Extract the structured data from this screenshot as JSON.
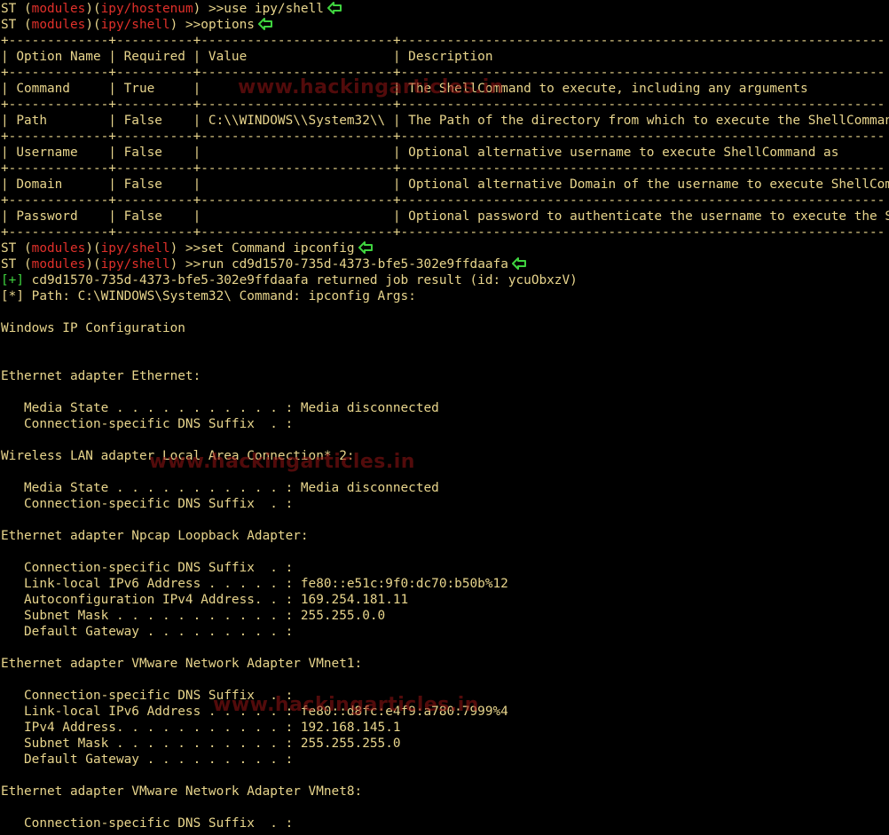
{
  "colors": {
    "background": "#000000",
    "text": "#e8d58c",
    "module_red": "#e0302a",
    "status_green": "#3fd33f",
    "arrow_green": "#3fd33f"
  },
  "prompt": {
    "prefix": "ST (",
    "module_word": "modules",
    "mid": ")(",
    "close": ")",
    "chevron": " >>"
  },
  "commands": {
    "c1": {
      "module": "ipy/hostenum",
      "text": "use ipy/shell"
    },
    "c2": {
      "module": "ipy/shell",
      "text": "options"
    },
    "c3": {
      "module": "ipy/shell",
      "text": "set Command ipconfig"
    },
    "c4": {
      "module": "ipy/shell",
      "text": "run cd9d1570-735d-4373-bfe5-302e9ffdaafa"
    }
  },
  "table": {
    "separator": "+-------------+----------+-------------------------+---------------------------------------------------------------",
    "header": "| Option Name | Required | Value                   | Description",
    "rows": [
      "| Command     | True     |                         | The ShellCommand to execute, including any arguments",
      "| Path        | False    | C:\\\\WINDOWS\\\\System32\\\\ | The Path of the directory from which to execute the ShellCommand",
      "| Username    | False    |                         | Optional alternative username to execute ShellCommand as",
      "| Domain      | False    |                         | Optional alternative Domain of the username to execute ShellCommand",
      "| Password    | False    |                         | Optional password to authenticate the username to execute the ShellCommand"
    ]
  },
  "status": {
    "plus_tag": "[+]",
    "plus_text": " cd9d1570-735d-4373-bfe5-302e9ffdaafa returned job result (id: ycuObxzV)",
    "star_tag": "[*]",
    "star_text": " Path: C:\\WINDOWS\\System32\\ Command: ipconfig Args:"
  },
  "output": [
    "",
    "Windows IP Configuration",
    "",
    "",
    "Ethernet adapter Ethernet:",
    "",
    "   Media State . . . . . . . . . . . : Media disconnected",
    "   Connection-specific DNS Suffix  . :",
    "",
    "Wireless LAN adapter Local Area Connection* 2:",
    "",
    "   Media State . . . . . . . . . . . : Media disconnected",
    "   Connection-specific DNS Suffix  . :",
    "",
    "Ethernet adapter Npcap Loopback Adapter:",
    "",
    "   Connection-specific DNS Suffix  . :",
    "   Link-local IPv6 Address . . . . . : fe80::e51c:9f0:dc70:b50b%12",
    "   Autoconfiguration IPv4 Address. . : 169.254.181.11",
    "   Subnet Mask . . . . . . . . . . . : 255.255.0.0",
    "   Default Gateway . . . . . . . . . :",
    "",
    "Ethernet adapter VMware Network Adapter VMnet1:",
    "",
    "   Connection-specific DNS Suffix  . :",
    "   Link-local IPv6 Address . . . . . : fe80::d8fc:e4f9:a780:7999%4",
    "   IPv4 Address. . . . . . . . . . . : 192.168.145.1",
    "   Subnet Mask . . . . . . . . . . . : 255.255.255.0",
    "   Default Gateway . . . . . . . . . :",
    "",
    "Ethernet adapter VMware Network Adapter VMnet8:",
    "",
    "   Connection-specific DNS Suffix  . :"
  ],
  "watermark": {
    "text": "www.hackingarticles.in"
  }
}
